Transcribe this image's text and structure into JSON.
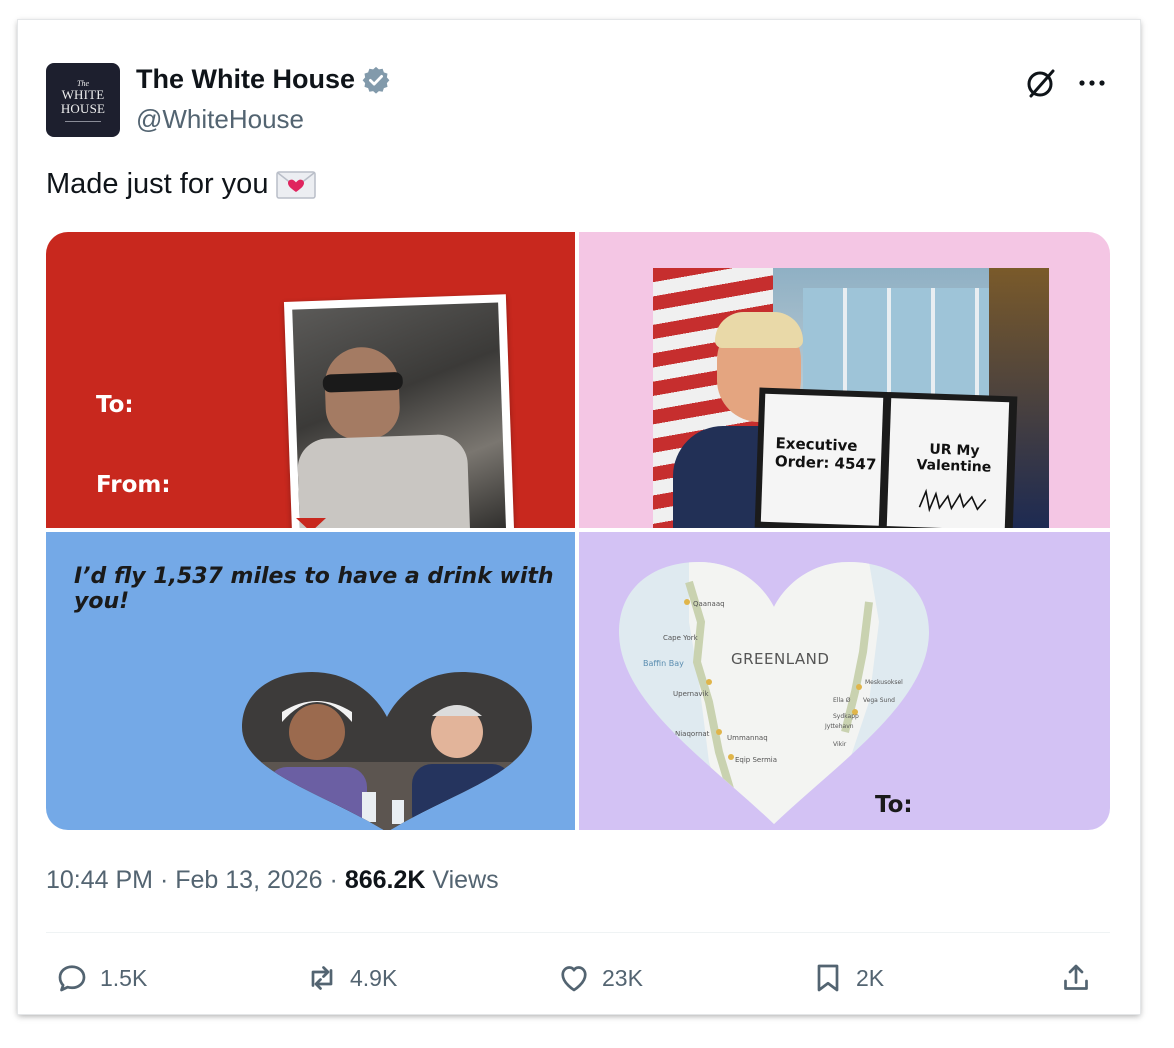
{
  "post": {
    "author": "The White House",
    "handle": "@WhiteHouse",
    "avatar_lines": [
      "The",
      "WHITE",
      "HOUSE"
    ],
    "text": "Made just for you",
    "emoji": "💌"
  },
  "media": {
    "card1": {
      "to": "To:",
      "from": "From:"
    },
    "card2": {
      "sign_left": "Executive Order: 4547",
      "sign_right": "UR My Valentine"
    },
    "card3": {
      "headline": "I’d fly 1,537 miles to have a drink with you!"
    },
    "card4": {
      "map_title": "GREENLAND",
      "bay_label": "Baffin Bay",
      "places": [
        "Qaanaaq",
        "Cape York",
        "Upernavik",
        "Niaqornat",
        "Ummannaq",
        "Eqip Sermia",
        "Ella Ø",
        "Sydkapp",
        "Jyttehavn",
        "Vikir",
        "Meskusoksel",
        "Vega Sund"
      ],
      "to": "To:"
    }
  },
  "meta": {
    "time": "10:44 PM",
    "date": "Feb 13, 2026",
    "views_count": "866.2K",
    "views_label": "Views"
  },
  "actions": {
    "replies": "1.5K",
    "reposts": "4.9K",
    "likes": "23K",
    "bookmarks": "2K"
  },
  "colors": {
    "verified": "#829aab",
    "card1_bg": "#c8281e",
    "card2_bg": "#f4c6e4",
    "card3_bg": "#74a9e7",
    "card4_bg": "#d3c2f4"
  },
  "icons": [
    "verified-badge-icon",
    "grok-icon",
    "more-icon",
    "love-letter-icon",
    "reply-icon",
    "repost-icon",
    "like-icon",
    "bookmark-icon",
    "share-icon"
  ]
}
